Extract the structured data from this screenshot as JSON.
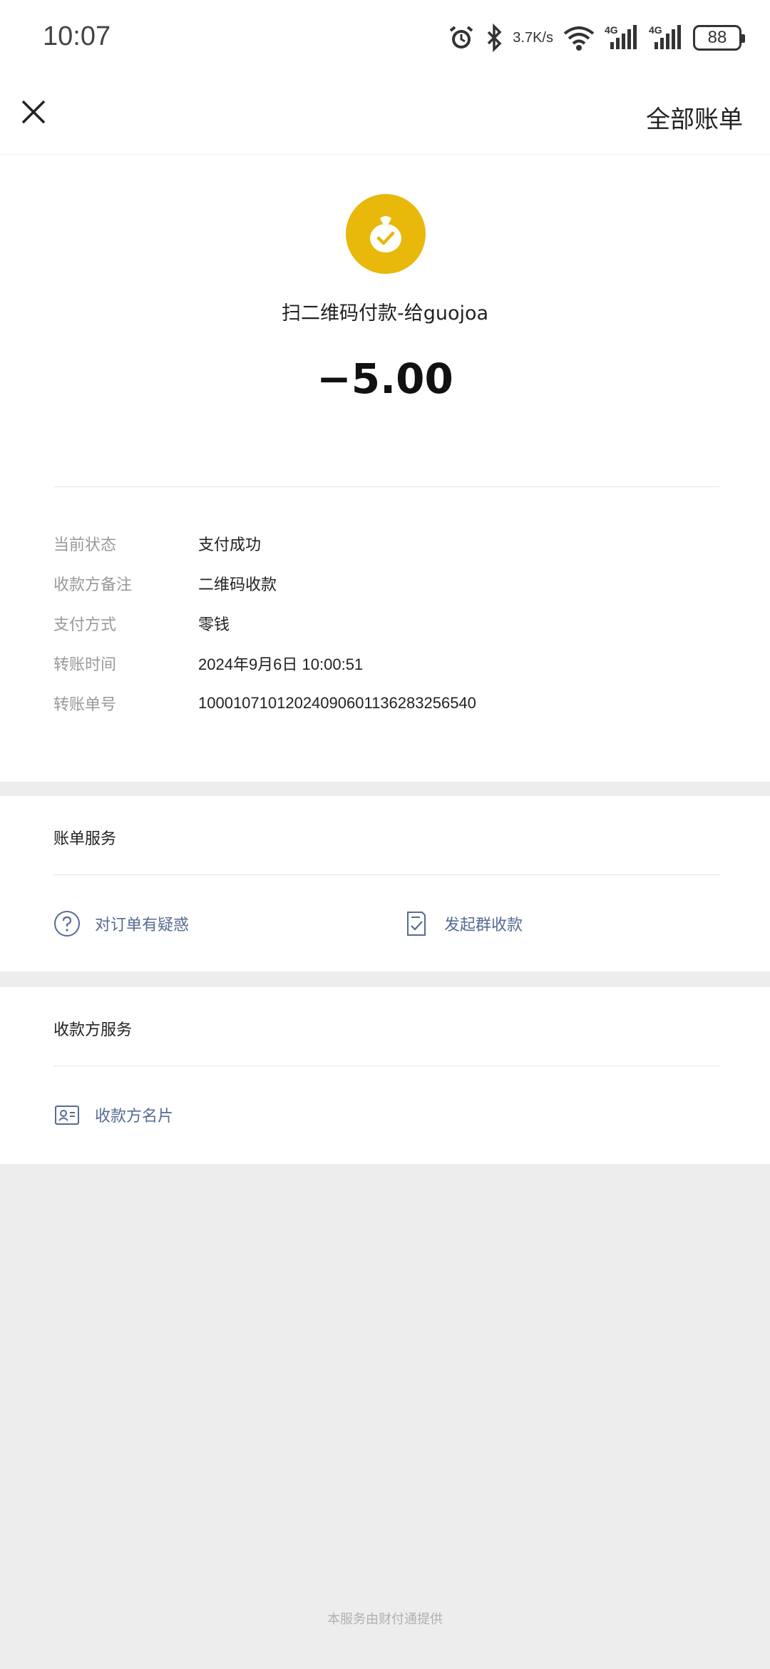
{
  "status_bar": {
    "time": "10:07",
    "speed_top": "3.7",
    "speed_bottom": "K/s",
    "network_1": "4G",
    "network_2": "4G",
    "battery": "88"
  },
  "nav": {
    "close_icon": "close-icon",
    "right_link": "全部账单"
  },
  "transaction": {
    "icon": "money-bag-check-icon",
    "icon_color": "#e8b80b",
    "merchant": "扫二维码付款-给guojoa",
    "amount": "−5.00",
    "details": [
      {
        "label": "当前状态",
        "value": "支付成功"
      },
      {
        "label": "收款方备注",
        "value": "二维码收款"
      },
      {
        "label": "支付方式",
        "value": "零钱"
      },
      {
        "label": "转账时间",
        "value": "2024年9月6日 10:00:51"
      },
      {
        "label": "转账单号",
        "value": "100010710120240906011362832565​40"
      }
    ]
  },
  "bill_services": {
    "title": "账单服务",
    "items": [
      {
        "label": "对订单有疑惑",
        "icon": "question-circle-icon"
      },
      {
        "label": "发起群收款",
        "icon": "document-check-icon"
      }
    ]
  },
  "payee_services": {
    "title": "收款方服务",
    "items": [
      {
        "label": "收款方名片",
        "icon": "contact-card-icon"
      }
    ]
  },
  "footer": "本服务由财付通提供",
  "colors": {
    "link": "#576b95",
    "background": "#ededed"
  }
}
